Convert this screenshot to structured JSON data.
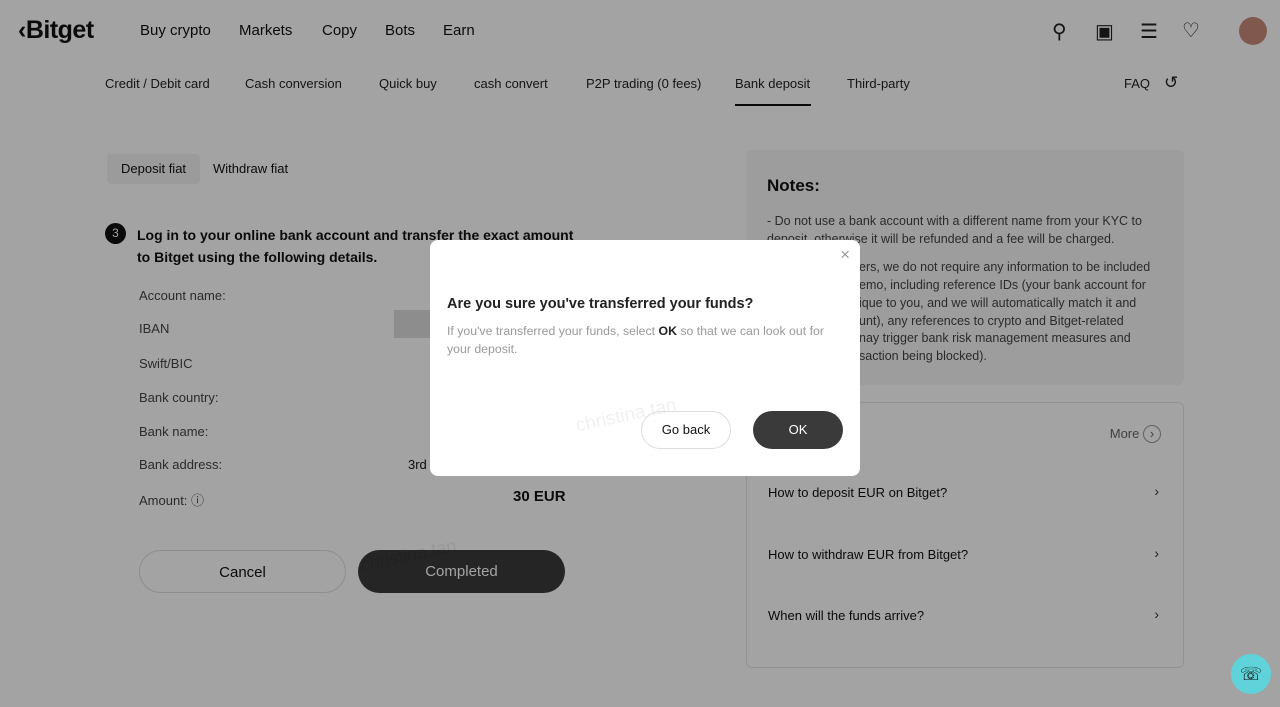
{
  "header": {
    "logo": "Bitget",
    "nav": [
      "Buy crypto",
      "Markets",
      "Copy",
      "Bots",
      "Earn"
    ],
    "icons": [
      "search-icon",
      "wallet-icon",
      "orders-icon",
      "bell-icon",
      "avatar"
    ]
  },
  "subnav": {
    "tabs": [
      "Credit / Debit card",
      "Cash conversion",
      "Quick buy",
      "cash convert",
      "P2P trading (0 fees)",
      "Bank deposit",
      "Third-party"
    ],
    "active": "Bank deposit",
    "faq": "FAQ"
  },
  "toggle": {
    "deposit": "Deposit fiat",
    "withdraw": "Withdraw fiat"
  },
  "step": {
    "number": "3",
    "text": "Log in to your online bank account and transfer the exact amount to Bitget using the following details."
  },
  "fields": {
    "account_name": "Account name:",
    "iban": "IBAN",
    "swift": "Swift/BIC",
    "bank_country": "Bank country:",
    "bank_name": "Bank name:",
    "bank_address": "Bank address:",
    "bank_address_value": "3rd",
    "amount": "Amount:",
    "amount_value": "30 EUR"
  },
  "buttons": {
    "cancel": "Cancel",
    "completed": "Completed"
  },
  "notes": {
    "title": "Notes:",
    "line1": "- Do not use a bank account with a different name from your KYC to",
    "line2": "deposit, otherwise it will be refunded and a fee will be charged.",
    "line3": "ers, we do not require any information to be included",
    "line4": "emo, including reference IDs (your bank account for",
    "line5": "ique to you, and we will automatically match it and",
    "line6": "unt), any references to crypto and Bitget-related",
    "line7": "nay trigger bank risk management measures and",
    "line8": "saction being blocked)."
  },
  "faq": {
    "more": "More",
    "items": [
      "How to deposit EUR on Bitget?",
      "How to withdraw EUR from Bitget?",
      "When will the funds arrive?"
    ]
  },
  "modal": {
    "title": "Are you sure you've transferred your funds?",
    "body_pre": "If you've transferred your funds, select ",
    "body_bold": "OK",
    "body_post": " so that we can look out for your deposit.",
    "go_back": "Go back",
    "ok": "OK"
  },
  "watermark": "christina.tan",
  "colors": {
    "primary_button": "#3a3a3a",
    "support": "#5fd3d9"
  }
}
